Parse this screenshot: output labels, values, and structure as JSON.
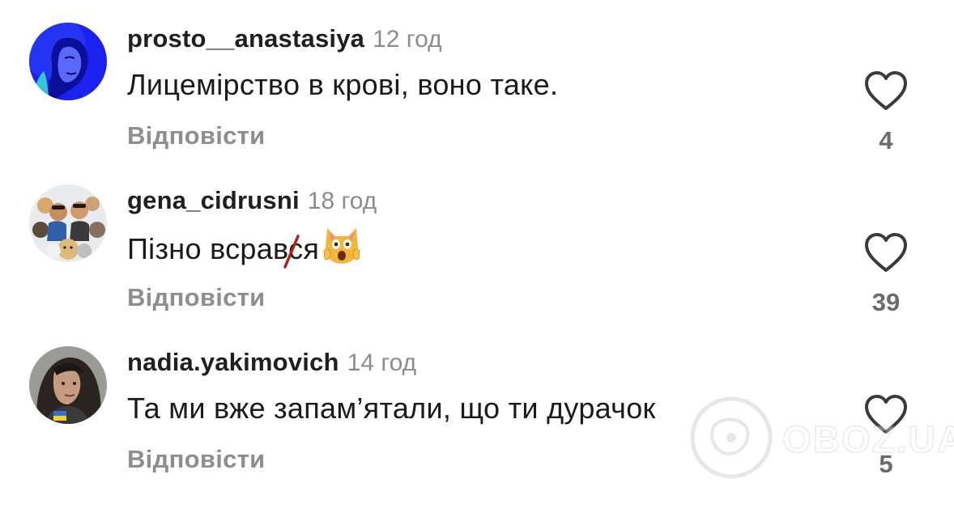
{
  "comments": [
    {
      "username": "prosto__anastasiya",
      "time": "12 год",
      "text": "Лицемірство в крові, воно таке.",
      "reply_label": "Відповісти",
      "likes": "4",
      "avatar_icon": "avatar-woman-blue-icon"
    },
    {
      "username": "gena_cidrusni",
      "time": "18 год",
      "text": "Пізно всрався",
      "reply_label": "Відповісти",
      "likes": "39",
      "avatar_icon": "avatar-men-with-dogs-icon",
      "emoji": "screaming-cat-emoji"
    },
    {
      "username": "nadia.yakimovich",
      "time": "14 год",
      "text": "Та ми вже запам’ятали, що ти дурачок",
      "reply_label": "Відповісти",
      "likes": "5",
      "avatar_icon": "avatar-woman-dark-hair-icon"
    }
  ],
  "watermark": {
    "text": "OBOZ.UA"
  },
  "colors": {
    "username": "#1f1f1f",
    "time": "#8c8c8c",
    "reply": "#8e8e8e",
    "count": "#6b6b6b",
    "heart_stroke": "#3a3a3a",
    "avatar1_bg": "#1e2ef0",
    "slash": "#b0201a"
  }
}
